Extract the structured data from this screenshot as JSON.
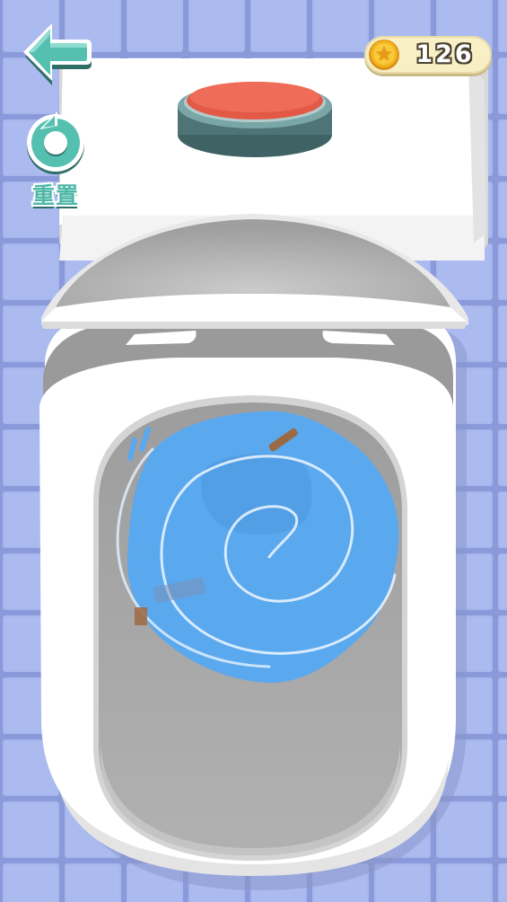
{
  "hud": {
    "back_icon": "back-arrow-icon",
    "reset_icon": "reset-icon",
    "reset_label": "重置",
    "coin_icon": "star-coin-icon",
    "coin_count": "126"
  },
  "scene": {
    "flush_button_icon": "flush-button-icon",
    "colors": {
      "floor_tile": "#a7b6ec",
      "grout": "#8796d8",
      "porcelain": "#ffffff",
      "bowl_interior": "#a9a9a9",
      "water": "#5aa8ee",
      "flush_button": "#ec6a55",
      "button_base": "#4f7477",
      "accent": "#4fb8a8",
      "coin": "#f2b31b"
    }
  }
}
